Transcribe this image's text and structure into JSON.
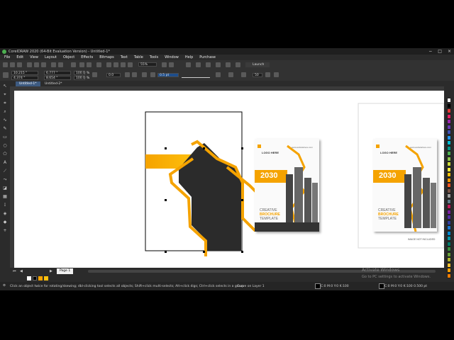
{
  "window": {
    "title": "CorelDRAW 2020 (64-Bit Evaluation Version) - Untitled-1*",
    "controls": [
      "−",
      "□",
      "×"
    ]
  },
  "menu": [
    "File",
    "Edit",
    "View",
    "Layout",
    "Object",
    "Effects",
    "Bitmaps",
    "Text",
    "Table",
    "Tools",
    "Window",
    "Help",
    "Purchase"
  ],
  "standard_toolbar": {
    "zoom": "55%",
    "launch_label": "Launch"
  },
  "property_bar": {
    "x": "10.215 \"",
    "y": "4.374 \"",
    "width": "6.777 \"",
    "height": "8.654 \"",
    "scale_w": "100.0",
    "scale_h": "100.0",
    "pct": "%",
    "rotation": "0.0",
    "outline": "0.5 pt",
    "nodes": "50"
  },
  "tabs": [
    {
      "label": "Untitled-1*",
      "active": true
    },
    {
      "label": "Untitled-2*",
      "active": false
    }
  ],
  "page_tab": "Page 1",
  "status": {
    "hint": "Click an object twice for rotating/skewing; dbl-clicking tool selects all objects; Shift+click multi-selects; Alt+click digs; Ctrl+click selects in a group",
    "object": "Curve on Layer 1",
    "fill": "C:0 M:0 Y:0 K:100",
    "outline": "C:0 M:0 Y:0 K:100  0.500 pt"
  },
  "watermark": {
    "line1": "Activate Windows",
    "line2": "Go to PC settings to activate Windows."
  },
  "brochure": {
    "logo": "LOGO HERE",
    "website": "www.websitehere.com",
    "year": "2030",
    "line1": "CREATIVE",
    "line2": "BROCHURE",
    "line3": "TEMPLATE",
    "note": "IMAGE NOT INCLUDED"
  },
  "colors": {
    "accent_orange": "#f5a300",
    "accent_yellow": "#ffc20e",
    "shape_dark": "#2b2b2b",
    "ui_dark": "#2b2b2b",
    "tab_active": "#3d5a80"
  },
  "palette_swatches": [
    "#ffffff",
    "#000000",
    "#e53935",
    "#e91e63",
    "#9c27b0",
    "#673ab7",
    "#3f51b5",
    "#2196f3",
    "#00bcd4",
    "#009688",
    "#4caf50",
    "#8bc34a",
    "#cddc39",
    "#ffeb3b",
    "#ffc107",
    "#ff9800",
    "#ff5722",
    "#795548",
    "#9e9e9e",
    "#607d8b",
    "#c2185b",
    "#7b1fa2",
    "#512da8",
    "#303f9f",
    "#1976d2",
    "#0288d1",
    "#0097a7",
    "#00796b",
    "#388e3c",
    "#689f38",
    "#afb42b",
    "#fbc02d",
    "#ffa000",
    "#f57c00"
  ]
}
